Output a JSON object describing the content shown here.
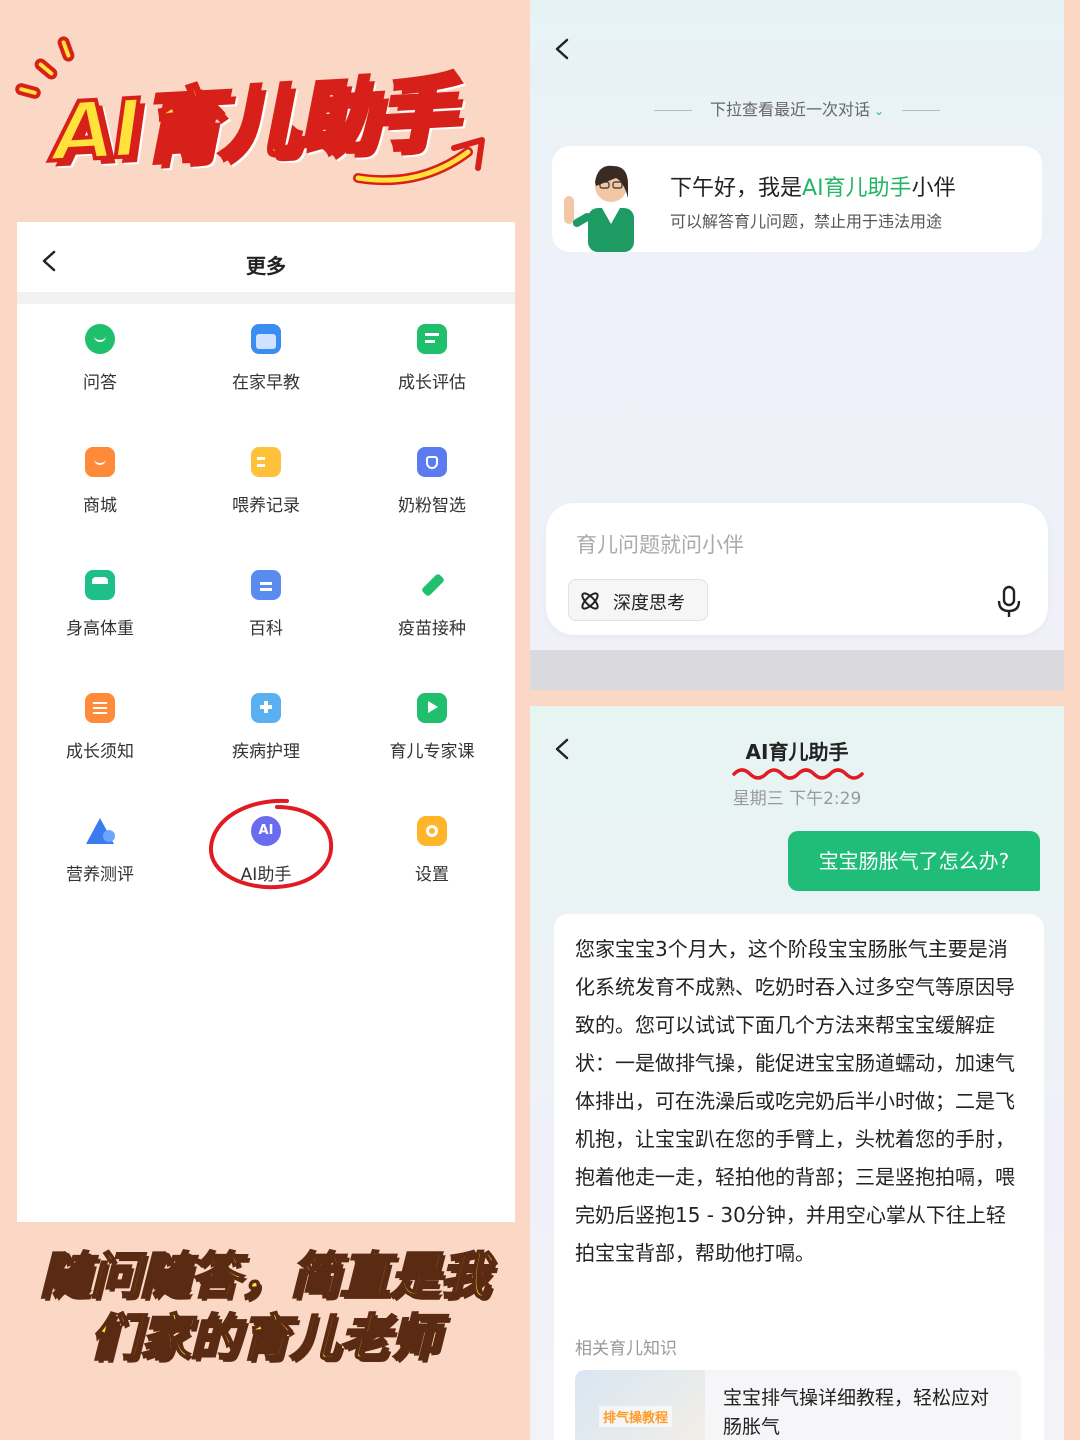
{
  "headline": {
    "text": "AI育儿助手"
  },
  "left_screen": {
    "title": "更多",
    "items": [
      {
        "label": "问答",
        "icon": "chat-bubble-icon",
        "color": "#1fbf6e"
      },
      {
        "label": "在家早教",
        "icon": "calendar-icon",
        "color": "#3a8ef0"
      },
      {
        "label": "成长评估",
        "icon": "report-icon",
        "color": "#1fbf6e"
      },
      {
        "label": "商城",
        "icon": "shopping-bag-icon",
        "color": "#ff8a3a"
      },
      {
        "label": "喂养记录",
        "icon": "bottle-icon",
        "color": "#ffc13a"
      },
      {
        "label": "奶粉智选",
        "icon": "formula-can-icon",
        "color": "#5a7cf0"
      },
      {
        "label": "身高体重",
        "icon": "scale-icon",
        "color": "#1fbf8a"
      },
      {
        "label": "百科",
        "icon": "book-icon",
        "color": "#5a8cf0"
      },
      {
        "label": "疫苗接种",
        "icon": "syringe-icon",
        "color": "#1fbf6e"
      },
      {
        "label": "成长须知",
        "icon": "clipboard-icon",
        "color": "#ff8a3a"
      },
      {
        "label": "疾病护理",
        "icon": "medical-kit-icon",
        "color": "#5ab0f0"
      },
      {
        "label": "育儿专家课",
        "icon": "video-board-icon",
        "color": "#1fbf6e"
      },
      {
        "label": "营养测评",
        "icon": "pyramid-icon",
        "color": "#3a7cf0"
      },
      {
        "label": "AI助手",
        "icon": "ai-badge-icon",
        "color": "#6a6cf0"
      },
      {
        "label": "设置",
        "icon": "settings-hex-icon",
        "color": "#ffb52a"
      }
    ]
  },
  "caption": {
    "line1": "随问随答，简直是我",
    "line2": "们家的育儿老师"
  },
  "chat_home": {
    "pull_hint": "下拉查看最近一次对话",
    "greeting_prefix": "下午好，我是",
    "greeting_highlight": "AI育儿助手",
    "greeting_suffix": "小伴",
    "greeting_sub": "可以解答育儿问题，禁止用于违法用途",
    "input_placeholder": "育儿问题就问小伴",
    "deep_think_label": "深度思考"
  },
  "chat_detail": {
    "title": "AI育儿助手",
    "date": "星期三 下午2:29",
    "user_message": "宝宝肠胀气了怎么办?",
    "answer": "您家宝宝3个月大，这个阶段宝宝肠胀气主要是消化系统发育不成熟、吃奶时吞入过多空气等原因导致的。您可以试试下面几个方法来帮宝宝缓解症状：一是做排气操，能促进宝宝肠道蠕动，加速气体排出，可在洗澡后或吃完奶后半小时做；二是飞机抱，让宝宝趴在您的手臂上，头枕着您的手肘，抱着他走一走，轻拍他的背部；三是竖抱拍嗝，喂完奶后竖抱15 - 30分钟，并用空心掌从下往上轻拍宝宝背部，帮助他打嗝。",
    "related_label": "相关育儿知识",
    "related_thumb_tag": "排气操教程",
    "related_title": "宝宝排气操详细教程，轻松应对肠胀气"
  }
}
